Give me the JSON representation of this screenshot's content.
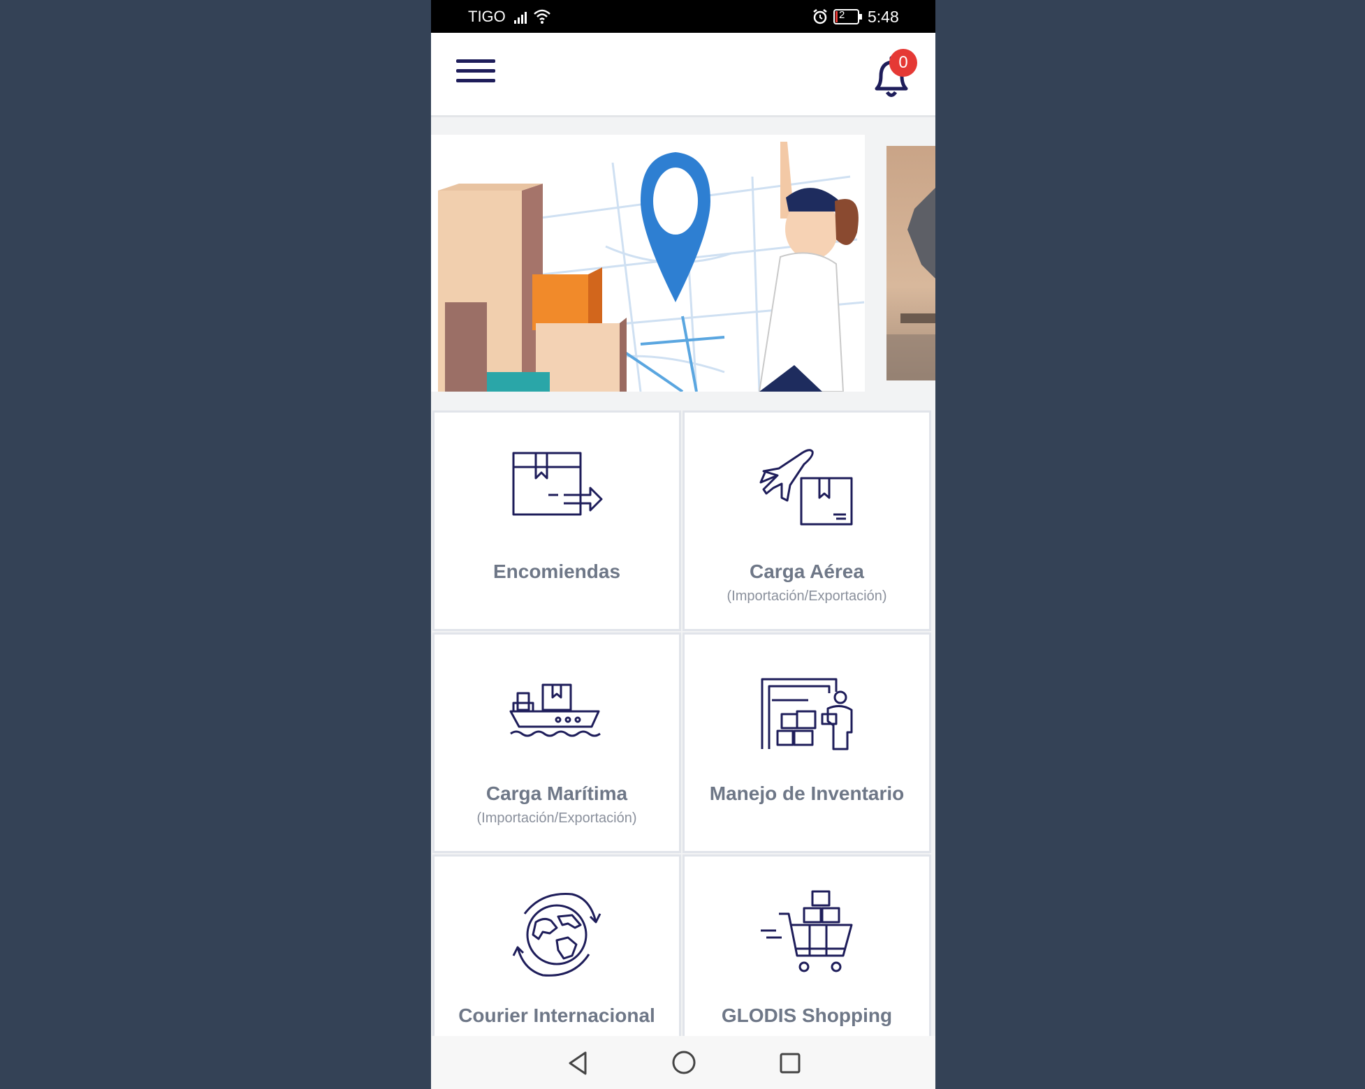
{
  "status_bar": {
    "carrier": "TIGO",
    "battery_level": "2",
    "time": "5:48"
  },
  "header": {
    "menu_icon": "hamburger-menu-icon",
    "notification_icon": "bell-icon",
    "notification_count": "0"
  },
  "carousel": {
    "slides": [
      {
        "image": "delivery-map-pilot-illustration"
      },
      {
        "image": "ship-photo"
      }
    ]
  },
  "services": [
    {
      "title": "Encomiendas",
      "subtitle": "",
      "icon": "package-arrow-icon"
    },
    {
      "title": "Carga Aérea",
      "subtitle": "(Importación/Exportación)",
      "icon": "airplane-box-icon"
    },
    {
      "title": "Carga Marítima",
      "subtitle": "(Importación/Exportación)",
      "icon": "ship-cargo-icon"
    },
    {
      "title": "Manejo de Inventario",
      "subtitle": "",
      "icon": "warehouse-worker-icon"
    },
    {
      "title": "Courier Internacional",
      "subtitle": "",
      "icon": "globe-arrows-icon"
    },
    {
      "title": "GLODIS Shopping",
      "subtitle": "",
      "icon": "shopping-cart-boxes-icon"
    }
  ],
  "nav_bar": {
    "back_icon": "back-triangle-icon",
    "home_icon": "home-circle-icon",
    "recent_icon": "recent-apps-square-icon"
  },
  "colors": {
    "background": "#344256",
    "icon_navy": "#1e1d5a",
    "title_gray": "#6e7787",
    "badge_red": "#e53935"
  }
}
